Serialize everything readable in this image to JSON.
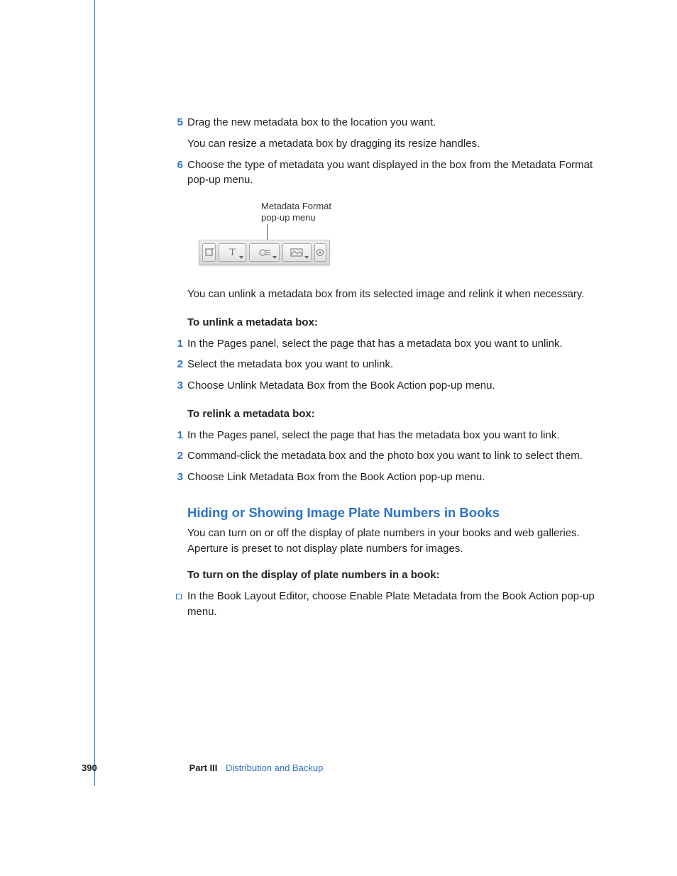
{
  "steps_a": [
    {
      "n": "5",
      "lines": [
        "Drag the new metadata box to the location you want."
      ],
      "after": "You can resize a metadata box by dragging its resize handles."
    },
    {
      "n": "6",
      "lines": [
        "Choose the type of metadata you want displayed in the box from the Metadata Format pop-up menu."
      ]
    }
  ],
  "figure": {
    "callout_l1": "Metadata Format",
    "callout_l2": "pop-up menu"
  },
  "para_unlink_intro": "You can unlink a metadata box from its selected image and relink it when necessary.",
  "head_unlink": "To unlink a metadata box:",
  "steps_unlink": [
    {
      "n": "1",
      "t": "In the Pages panel, select the page that has a metadata box you want to unlink."
    },
    {
      "n": "2",
      "t": "Select the metadata box you want to unlink."
    },
    {
      "n": "3",
      "t": "Choose Unlink Metadata Box from the Book Action pop-up menu."
    }
  ],
  "head_relink": "To relink a metadata box:",
  "steps_relink": [
    {
      "n": "1",
      "t": "In the Pages panel, select the page that has the metadata box you want to link."
    },
    {
      "n": "2",
      "t": "Command-click the metadata box and the photo box you want to link to select them."
    },
    {
      "n": "3",
      "t": "Choose Link Metadata Box from the Book Action pop-up menu."
    }
  ],
  "section_heading": "Hiding or Showing Image Plate Numbers in Books",
  "section_para": "You can turn on or off the display of plate numbers in your books and web galleries. Aperture is preset to not display plate numbers for images.",
  "head_plate": "To turn on the display of plate numbers in a book:",
  "bullet_plate": "In the Book Layout Editor, choose Enable Plate Metadata from the Book Action pop-up menu.",
  "footer": {
    "page": "390",
    "part": "Part III",
    "chapter": "Distribution and Backup"
  }
}
